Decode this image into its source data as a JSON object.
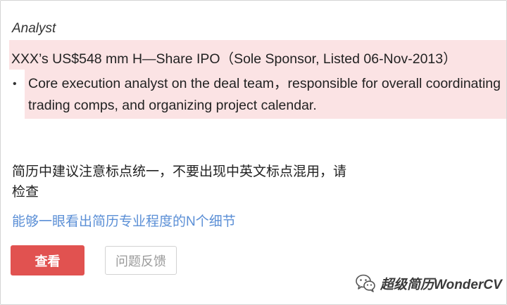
{
  "experience": {
    "role": "Analyst",
    "deal": "XXX’s US$548 mm H—Share IPO（Sole Sponsor, Listed 06-Nov-2013）",
    "bullet_marker": "•",
    "bullet_lines": [
      "Core execution analyst on the deal team，responsible for overall coordinating",
      "trading comps, and organizing project calendar."
    ]
  },
  "note": {
    "lines": [
      "简历中建议注意标点统一，不要出现中英文标点混用，请",
      "检查"
    ]
  },
  "link": {
    "label": "能够一眼看出简历专业程度的N个细节"
  },
  "buttons": {
    "view_label": "查看",
    "feedback_label": "问题反馈"
  },
  "watermark": {
    "text": "超级简历WonderCV",
    "icon": "wechat-icon"
  },
  "colors": {
    "highlight": "#fbe3e4",
    "accent_button": "#e15250",
    "link": "#5b8fd6"
  }
}
